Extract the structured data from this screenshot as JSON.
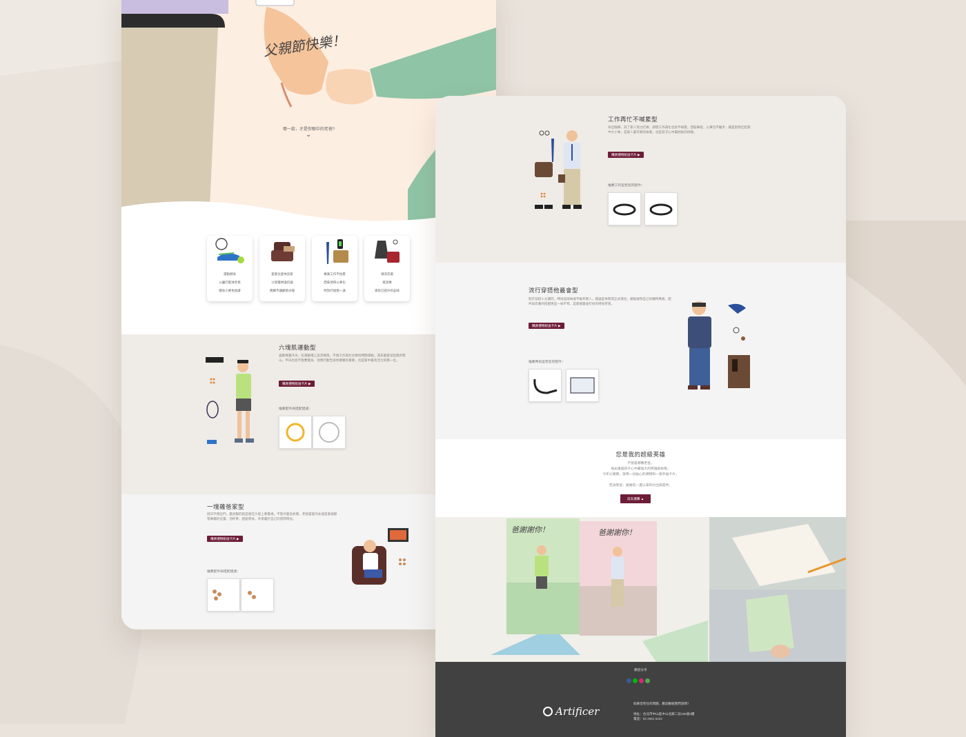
{
  "hero": {
    "script_title": "父親節快樂！",
    "question": "哪一款，才是你眼中的老爸?",
    "chevron": "chevron-down-icon"
  },
  "categories": [
    {
      "line1": "運動健身",
      "line2": "公園打籃球老爸",
      "line3": "健身小麥色肌膚"
    },
    {
      "line1": "愛家也愛休息家",
      "line2": "沙發電視遙控器",
      "line3": "偶爾不讓顧爸尖端"
    },
    {
      "line1": "專業工作不怕累",
      "line2": "西裝領帶公事包",
      "line3": "時刻打給我一通"
    },
    {
      "line1": "潮流衣著",
      "line2": "搖滾樂",
      "line3": "香氛已提升的品味"
    }
  ],
  "sections_left": {
    "six_pack": {
      "title": "六塊肌運動型",
      "body": "喜歡揮灑汗水，在運動場上追求極限，不畏工作再忙也要找時間運動。週末最愛早起跑步爬山，平日也從不放棄健身，他用行動告訴你健康的重要，也是家中最有活力的那一位。",
      "button": "購買禮物組送卡片 ▶",
      "recommend": "推薦配件與搭配建議："
    },
    "homebody": {
      "title": "一塊雞爸家型",
      "body": "假日不用出門，最舒服的就是窩在沙發上看電視。不管外面多熱鬧，老爸最愛的永遠是家裡那張專屬的位置，泡杯茶、配點零食，享受屬於自己的悠閒時光。",
      "button": "購買禮物組送卡片 ▶",
      "recommend": "推薦配件與搭配建議："
    }
  },
  "sections_right": {
    "workaholic": {
      "title": "工作再忙不喊累型",
      "body": "早出晚歸，為了家人努力打拼，即使工作再忙也從不喊累。西裝筆挺、公事包不離手，總是默默扛起家中大小事，是家人最可靠的依靠，也是孩子心中最帥氣的榜樣。",
      "button": "購買禮物組送卡片 ▶",
      "recommend": "推薦工作型老爸的配件："
    },
    "fashion": {
      "title": "流行穿搭他最會型",
      "body": "對於穿搭十分講究，時尚品味絲毫不輸年輕人。無論是休閒或正式場合，總能展現自己的獨特風格，配件與衣著的搭配更是一絲不苟，是家裡最會打扮的時尚老爸。",
      "button": "購買禮物組送卡片 ▶",
      "recommend": "推薦時尚型老爸的配件："
    },
    "hero_section": {
      "title": "您是我的超級英雄",
      "lines": [
        "不管是哪種老爸，",
        "他永遠是孩子心中最強大的英雄與依靠。",
        "今年父親節，就用一份貼心的禮物和一張手繪卡片，",
        "告訴老爸：謝謝您一直以來的付出與陪伴。"
      ],
      "button": "前去選購 ▲"
    },
    "card_word": "爸謝謝你！",
    "footer": {
      "share": "歡迎分享",
      "contact": "如果您有任何問題，歡迎聯絡我們詢問！",
      "logo_text": "Artificer",
      "addr": "地址：台北市中山區中山北路二段155號3樓",
      "tel": "電話：02 2581 6222"
    }
  },
  "colors": {
    "accent": "#6d1d37",
    "hero_bg": "#fdeee2",
    "sleeve_green": "#8fc4a6",
    "section_beige": "#efebe7",
    "section_gray": "#f4f4f4",
    "footer": "#414141"
  }
}
